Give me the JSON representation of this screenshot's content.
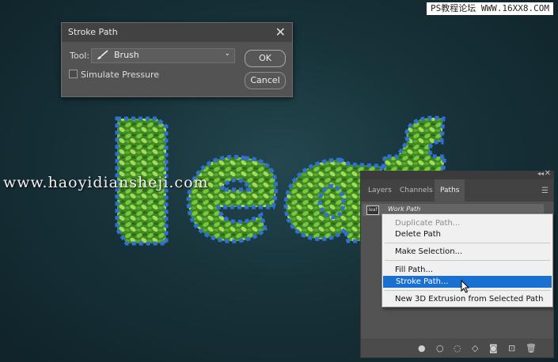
{
  "watermarks": {
    "top": "PS教程论坛 WWW.16XX8.COM",
    "middle": "www.haoyidiansheji.com"
  },
  "dialog": {
    "title": "Stroke Path",
    "tool_label": "Tool:",
    "tool_value": "Brush",
    "simulate_pressure_label": "Simulate Pressure",
    "simulate_pressure_checked": false,
    "ok_label": "OK",
    "cancel_label": "Cancel"
  },
  "panel": {
    "tabs": [
      {
        "label": "Layers",
        "active": false
      },
      {
        "label": "Channels",
        "active": false
      },
      {
        "label": "Paths",
        "active": true
      }
    ],
    "path_item": {
      "thumb": "leaf",
      "name": "Work Path"
    },
    "footer_icons": [
      "fill-path-icon",
      "stroke-path-icon",
      "load-selection-icon",
      "make-work-path-icon",
      "add-mask-icon",
      "new-path-icon",
      "delete-path-icon"
    ]
  },
  "context_menu": {
    "items": [
      {
        "label": "Duplicate Path...",
        "disabled": true
      },
      {
        "label": "Delete Path",
        "disabled": false
      },
      {
        "label": "Make Selection...",
        "disabled": false
      },
      {
        "label": "Fill Path...",
        "disabled": false
      },
      {
        "label": "Stroke Path...",
        "disabled": false,
        "selected": true
      },
      {
        "label": "New 3D Extrusion from Selected Path",
        "disabled": false
      }
    ]
  },
  "artwork": {
    "text": "leaf",
    "fill_color": "#4f9e2c",
    "anchor_color": "#2f6fd6"
  }
}
